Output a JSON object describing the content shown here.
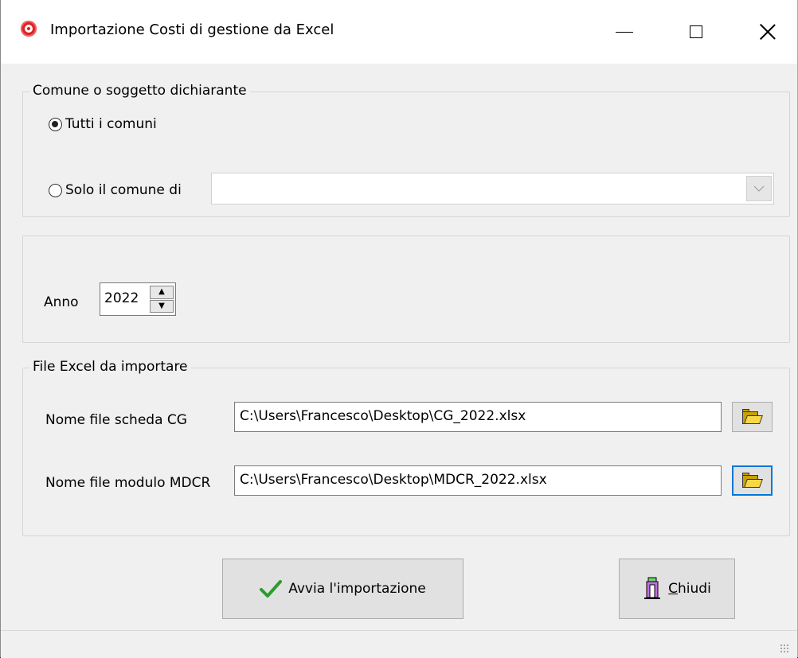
{
  "window": {
    "title": "Importazione Costi di gestione da Excel",
    "controls": {
      "minimize": "—",
      "maximize": "☐",
      "close": "✕"
    }
  },
  "group_comune": {
    "label": "Comune o soggetto dichiarante",
    "options": [
      {
        "label": "Tutti i comuni",
        "selected": true
      },
      {
        "label": "Solo il comune di",
        "selected": false
      }
    ],
    "comune_select_value": ""
  },
  "anno": {
    "label": "Anno",
    "value": "2022"
  },
  "group_files": {
    "label": "File Excel da importare",
    "cg": {
      "label": "Nome file scheda CG",
      "value": "C:\\Users\\Francesco\\Desktop\\CG_2022.xlsx",
      "browse_icon": "open-folder-icon"
    },
    "mdcr": {
      "label": "Nome file modulo MDCR",
      "value": "C:\\Users\\Francesco\\Desktop\\MDCR_2022.xlsx",
      "browse_icon": "open-folder-icon",
      "focused": true
    }
  },
  "buttons": {
    "start": {
      "label": "Avvia l'importazione",
      "icon": "check-icon"
    },
    "close": {
      "label": "Chiudi",
      "icon": "exit-door-icon"
    }
  },
  "colors": {
    "focus_border": "#0078d7",
    "check_green": "#2e9b2e",
    "app_icon_red": "#e02020"
  }
}
